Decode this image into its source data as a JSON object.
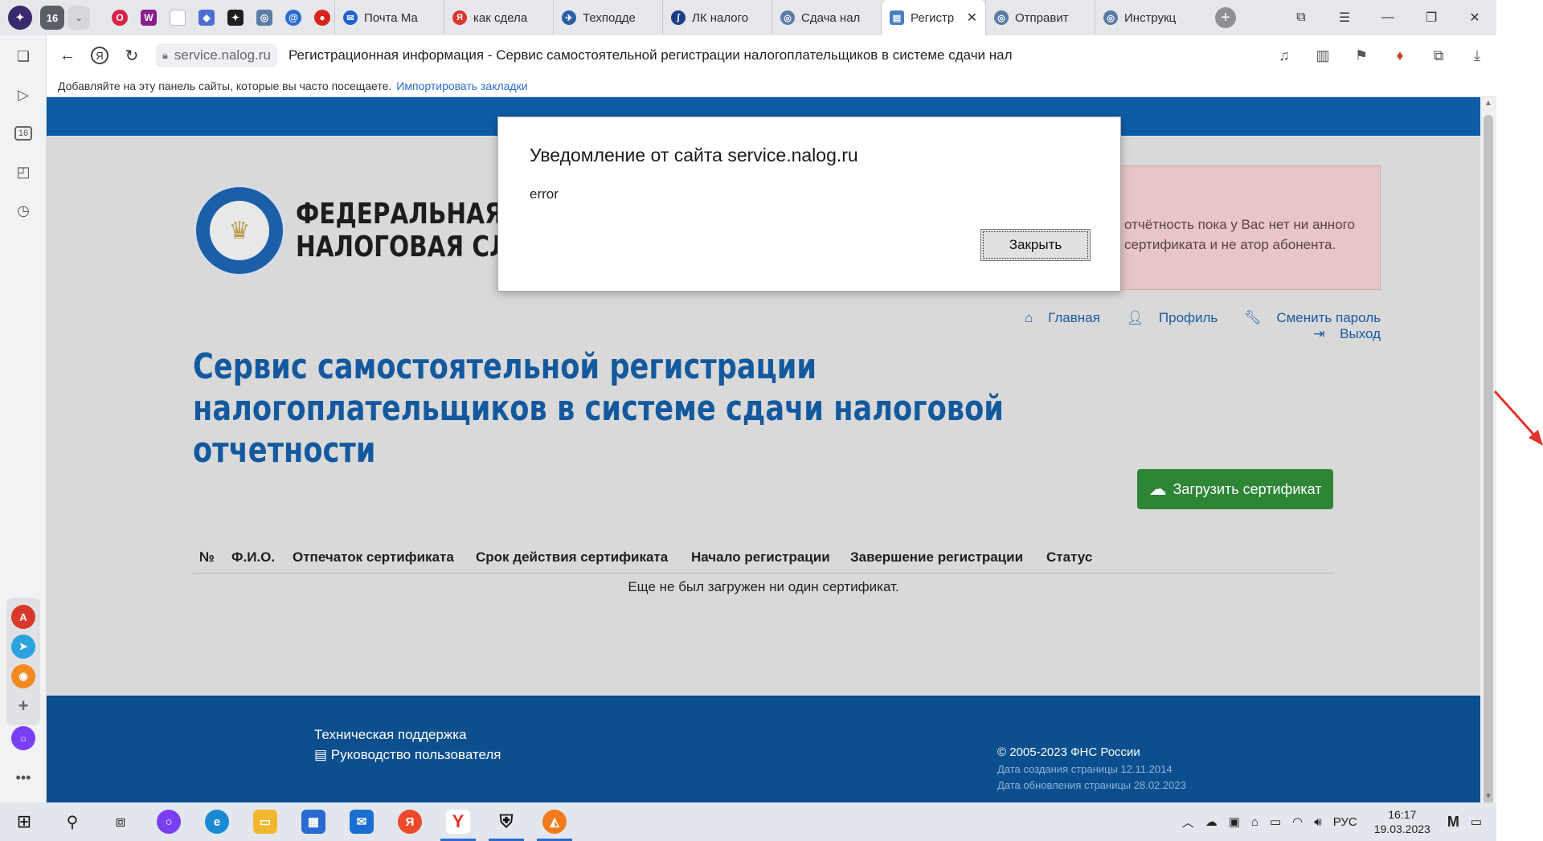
{
  "browser": {
    "tab_counter": "16",
    "tabs": [
      {
        "label": "Почта Ма",
        "color": "#1e63d6",
        "glyph": "✉"
      },
      {
        "label": "как сдела",
        "color": "#e0352b",
        "glyph": "Я"
      },
      {
        "label": "Техподде",
        "color": "#2a5ea8",
        "glyph": "✈"
      },
      {
        "label": "ЛК налого",
        "color": "#1b3d8a",
        "glyph": "∫"
      },
      {
        "label": "Сдача нал",
        "color": "#5b7ba8",
        "glyph": "◎"
      },
      {
        "label": "Регистр",
        "color": "#4a7fc0",
        "glyph": "▤"
      },
      {
        "label": "Отправит",
        "color": "#5b7ba8",
        "glyph": "◎"
      },
      {
        "label": "Инструкц",
        "color": "#5b7ba8",
        "glyph": "◎"
      }
    ],
    "url_host": "service.nalog.ru",
    "page_title": "Регистрационная информация - Сервис самостоятельной регистрации налогоплательщиков в системе сдачи налогово...",
    "bookmarks_hint": "Добавляйте на эту панель сайты, которые вы часто посещаете.",
    "bookmarks_import": "Импортировать закладки",
    "sidebar_counter": "16"
  },
  "page": {
    "logo_line1": "ФЕДЕРАЛЬНАЯ",
    "logo_line2": "НАЛОГОВАЯ СЛУЖБА",
    "alert_text": "отчётность пока у Вас нет ни анного сертификата и не атор абонента.",
    "links": {
      "home": "Главная",
      "profile": "Профиль",
      "change_password": "Сменить пароль",
      "logout": "Выход"
    },
    "title": "Сервис самостоятельной регистрации налогоплательщиков в системе сдачи налоговой отчетности",
    "upload_button": "Загрузить сертификат",
    "table": {
      "columns": [
        "№",
        "Ф.И.О.",
        "Отпечаток сертификата",
        "Срок действия сертификата",
        "Начало регистрации",
        "Завершение регистрации",
        "Статус"
      ],
      "empty_message": "Еще не был загружен ни один сертификат."
    },
    "footer": {
      "support": "Техническая поддержка",
      "manual": "Руководство пользователя",
      "copyright": "© 2005-2023 ФНС России",
      "created": "Дата создания страницы 12.11.2014",
      "updated": "Дата обновления страницы 28.02.2023"
    }
  },
  "dialog": {
    "title": "Уведомление от сайта service.nalog.ru",
    "message": "error",
    "close_button": "Закрыть"
  },
  "taskbar": {
    "language": "РУС",
    "time": "16:17",
    "date": "19.03.2023"
  },
  "colors": {
    "fns_blue": "#13599e",
    "header_strip": "#0e5ca6",
    "footer_bg": "#0c4f8f",
    "upload_green": "#2d8636",
    "alert_bg": "#e8c5c6",
    "annotation_red": "#e0352b"
  }
}
